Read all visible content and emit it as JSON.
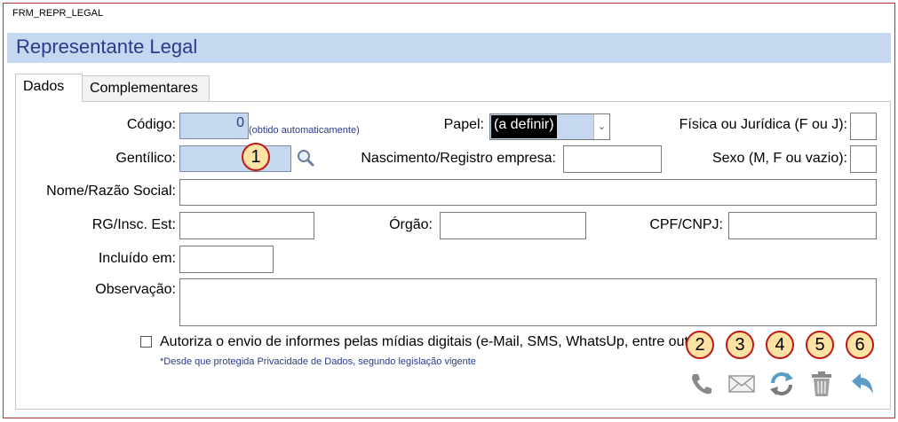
{
  "window": {
    "title": "FRM_REPR_LEGAL"
  },
  "header": {
    "title": "Representante Legal"
  },
  "tabs": [
    {
      "label": "Dados",
      "active": true
    },
    {
      "label": "Complementares",
      "active": false
    }
  ],
  "form": {
    "codigo": {
      "label": "Código:",
      "value": "0",
      "hint": "(obtido automaticamente)"
    },
    "papel": {
      "label": "Papel:",
      "value": "(a definir)"
    },
    "fisica_juridica": {
      "label": "Física ou Jurídica (F ou J):",
      "value": ""
    },
    "gentilico": {
      "label": "Gentílico:",
      "value": ""
    },
    "nascimento": {
      "label": "Nascimento/Registro empresa:",
      "value": ""
    },
    "sexo": {
      "label": "Sexo (M, F ou vazio):",
      "value": ""
    },
    "nome": {
      "label": "Nome/Razão Social:",
      "value": ""
    },
    "rg": {
      "label": "RG/Insc. Est:",
      "value": ""
    },
    "orgao": {
      "label": "Órgão:",
      "value": ""
    },
    "cpf": {
      "label": "CPF/CNPJ:",
      "value": ""
    },
    "incluido": {
      "label": "Incluído em:",
      "value": ""
    },
    "observacao": {
      "label": "Observação:",
      "value": ""
    }
  },
  "consent": {
    "label": "Autoriza o envio de informes pelas mídias digitais (e-Mail, SMS, WhatsUp, entre outr",
    "note": "*Desde que protegida Privacidade de Dados, segundo legislação vigente",
    "checked": false
  },
  "markers": [
    "1",
    "2",
    "3",
    "4",
    "5",
    "6"
  ],
  "colors": {
    "accent": "#2a3a8c",
    "header_band": "#c5d8ef",
    "marker_border": "#c01818",
    "marker_fill": "#fde2a3"
  }
}
